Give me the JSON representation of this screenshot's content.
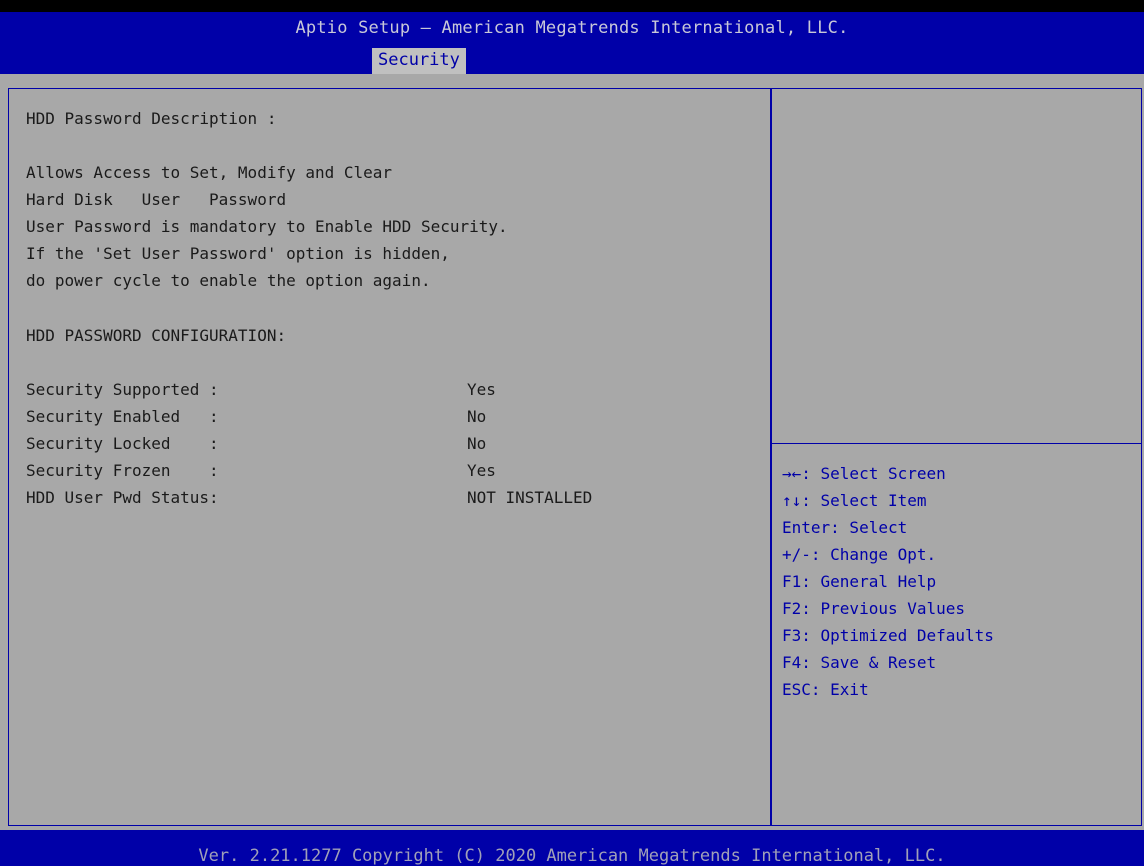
{
  "header": {
    "title": "Aptio Setup – American Megatrends International, LLC.",
    "active_tab": "Security"
  },
  "main": {
    "description_heading": "HDD Password Description :",
    "description_lines": [
      "Allows Access to Set, Modify and Clear",
      "Hard Disk   User   Password",
      "User Password is mandatory to Enable HDD Security.",
      "If the 'Set User Password' option is hidden,",
      "do power cycle to enable the option again."
    ],
    "config_heading": "HDD PASSWORD CONFIGURATION:",
    "status_rows": [
      {
        "label": "Security Supported :",
        "value": "Yes"
      },
      {
        "label": "Security Enabled   :",
        "value": "No"
      },
      {
        "label": "Security Locked    :",
        "value": "No"
      },
      {
        "label": "Security Frozen    :",
        "value": "Yes"
      },
      {
        "label": "HDD User Pwd Status:",
        "value": "NOT INSTALLED"
      }
    ]
  },
  "help": {
    "items": [
      "→←: Select Screen",
      "↑↓: Select Item",
      "Enter: Select",
      "+/-: Change Opt.",
      "F1: General Help",
      "F2: Previous Values",
      "F3: Optimized Defaults",
      "F4: Save & Reset",
      "ESC: Exit"
    ]
  },
  "footer": {
    "text": "Ver. 2.21.1277 Copyright (C) 2020 American Megatrends International, LLC."
  },
  "colors": {
    "header_bg": "#0000a8",
    "body_bg": "#a8a8a8",
    "help_text": "#0000a8",
    "tab_bg": "#c0c0c0"
  }
}
